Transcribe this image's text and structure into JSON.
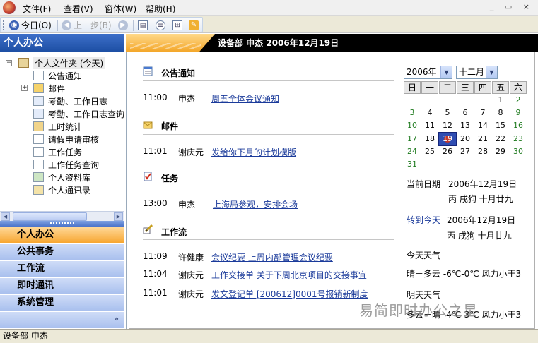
{
  "menubar": {
    "items": [
      "文件(F)",
      "查看(V)",
      "窗体(W)",
      "帮助(H)"
    ],
    "window_controls": "_ ▭ ×"
  },
  "toolbar": {
    "today_label": "今日(O)",
    "back_label": "上一步(B)"
  },
  "sidebar": {
    "title": "个人办公",
    "tree_root": "个人文件夹 (今天)",
    "tree_items": [
      {
        "label": "公告通知",
        "icon": "notice-icon",
        "expander": false
      },
      {
        "label": "邮件",
        "icon": "mail-icon",
        "expander": true
      },
      {
        "label": "考勤、工作日志",
        "icon": "calendar-grid-icon",
        "expander": false
      },
      {
        "label": "考勤、工作日志查询",
        "icon": "calendar-search-icon",
        "expander": false
      },
      {
        "label": "工时统计",
        "icon": "clock-icon",
        "expander": false
      },
      {
        "label": "请假申请审核",
        "icon": "leave-request-icon",
        "expander": false
      },
      {
        "label": "工作任务",
        "icon": "task-icon",
        "expander": false
      },
      {
        "label": "工作任务查询",
        "icon": "task-search-icon",
        "expander": false
      },
      {
        "label": "个人资料库",
        "icon": "library-icon",
        "expander": false
      },
      {
        "label": "个人通讯录",
        "icon": "contacts-icon",
        "expander": false
      }
    ],
    "nav_bars": [
      "个人办公",
      "公共事务",
      "工作流",
      "即时通讯",
      "系统管理"
    ],
    "active_nav": "个人办公"
  },
  "header": {
    "text": "设备部  申杰  2006年12月19日"
  },
  "sections": {
    "notice": {
      "title": "公告通知",
      "rows": [
        {
          "time": "11:00",
          "person": "申杰",
          "link": "周五全体会议通知"
        }
      ]
    },
    "mail": {
      "title": "邮件",
      "rows": [
        {
          "time": "11:01",
          "person": "谢庆元",
          "link": "发给你下月的计划模版"
        }
      ]
    },
    "task": {
      "title": "任务",
      "rows": [
        {
          "time": "13:00",
          "person": "申杰",
          "link": "上海局参观，安排会场"
        }
      ]
    },
    "workflow": {
      "title": "工作流",
      "rows": [
        {
          "time": "11:09",
          "person": "许健康",
          "link": "会议纪要  上周内部管理会议纪要"
        },
        {
          "time": "11:04",
          "person": "谢庆元",
          "link": "工作交接单  关于下周北京项目的交接事宜"
        },
        {
          "time": "11:01",
          "person": "谢庆元",
          "link": "发文登记单  [200612]0001号报销新制度"
        }
      ]
    }
  },
  "calendar": {
    "year": "2006年",
    "month": "十二月",
    "weekdays": [
      "日",
      "一",
      "二",
      "三",
      "四",
      "五",
      "六"
    ],
    "first_weekday": 5,
    "days_in_month": 31,
    "today": 19
  },
  "info": {
    "current_date_label": "当前日期",
    "current_date": "2006年12月19日",
    "lunar": "丙 戌狗  十月廿九",
    "goto_today": "转到今天",
    "goto_date": "2006年12月19日",
    "goto_lunar": "丙 戌狗  十月廿九",
    "weather_today_label": "今天天气",
    "weather_today": "晴－多云  -6℃-0℃  风力小于3",
    "weather_tomorrow_label": "明天天气",
    "weather_tomorrow": "多云－晴  -4℃-3℃  风力小于3"
  },
  "watermark": "易简即时办公之星",
  "statusbar": {
    "text": "设备部  申杰"
  }
}
